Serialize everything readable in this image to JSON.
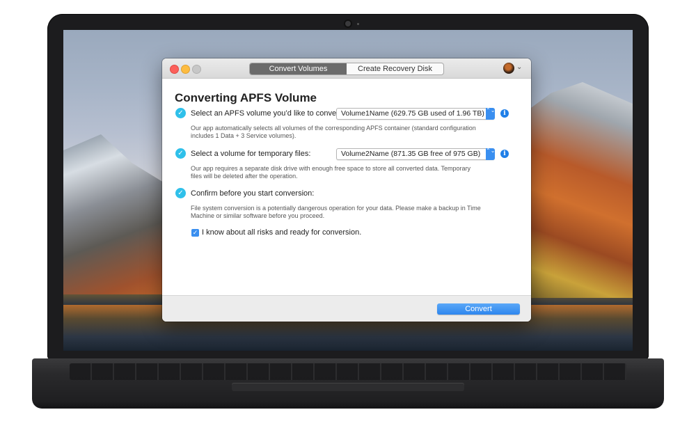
{
  "window": {
    "tabs": [
      {
        "label": "Convert Volumes",
        "active": true
      },
      {
        "label": "Create Recovery Disk",
        "active": false
      }
    ]
  },
  "main": {
    "heading": "Converting APFS Volume",
    "steps": [
      {
        "label": "Select an APFS volume you’d like to convert:",
        "select_value": "Volume1Name (629.75 GB used of 1.96 TB)",
        "description_line1": "Our app automatically selects all volumes of the corresponding APFS container (standard configuration",
        "description_line2": "includes 1 Data + 3 Service volumes)."
      },
      {
        "label": "Select a volume for temporary files:",
        "select_value": "Volume2Name (871.35 GB free of 975 GB)",
        "description_line1": "Our app requires a separate disk drive with enough free space to store all converted data. Temporary",
        "description_line2": "files will be deleted after the operation."
      },
      {
        "label": "Confirm before you start conversion:",
        "description_line1": "File system conversion is a potentially dangerous operation for your data. Please make a backup in Time",
        "description_line2": "Machine or similar software before you proceed."
      }
    ],
    "risk_checkbox": {
      "label": "I know about all risks and ready for conversion.",
      "checked": true
    }
  },
  "footer": {
    "convert_label": "Convert"
  },
  "colors": {
    "accent": "#2fc0ea",
    "button": "#2d86ee"
  },
  "icons": {
    "step_check": "✓",
    "stepper": "⌃⌄",
    "info": "i",
    "chevron": "⌄"
  }
}
